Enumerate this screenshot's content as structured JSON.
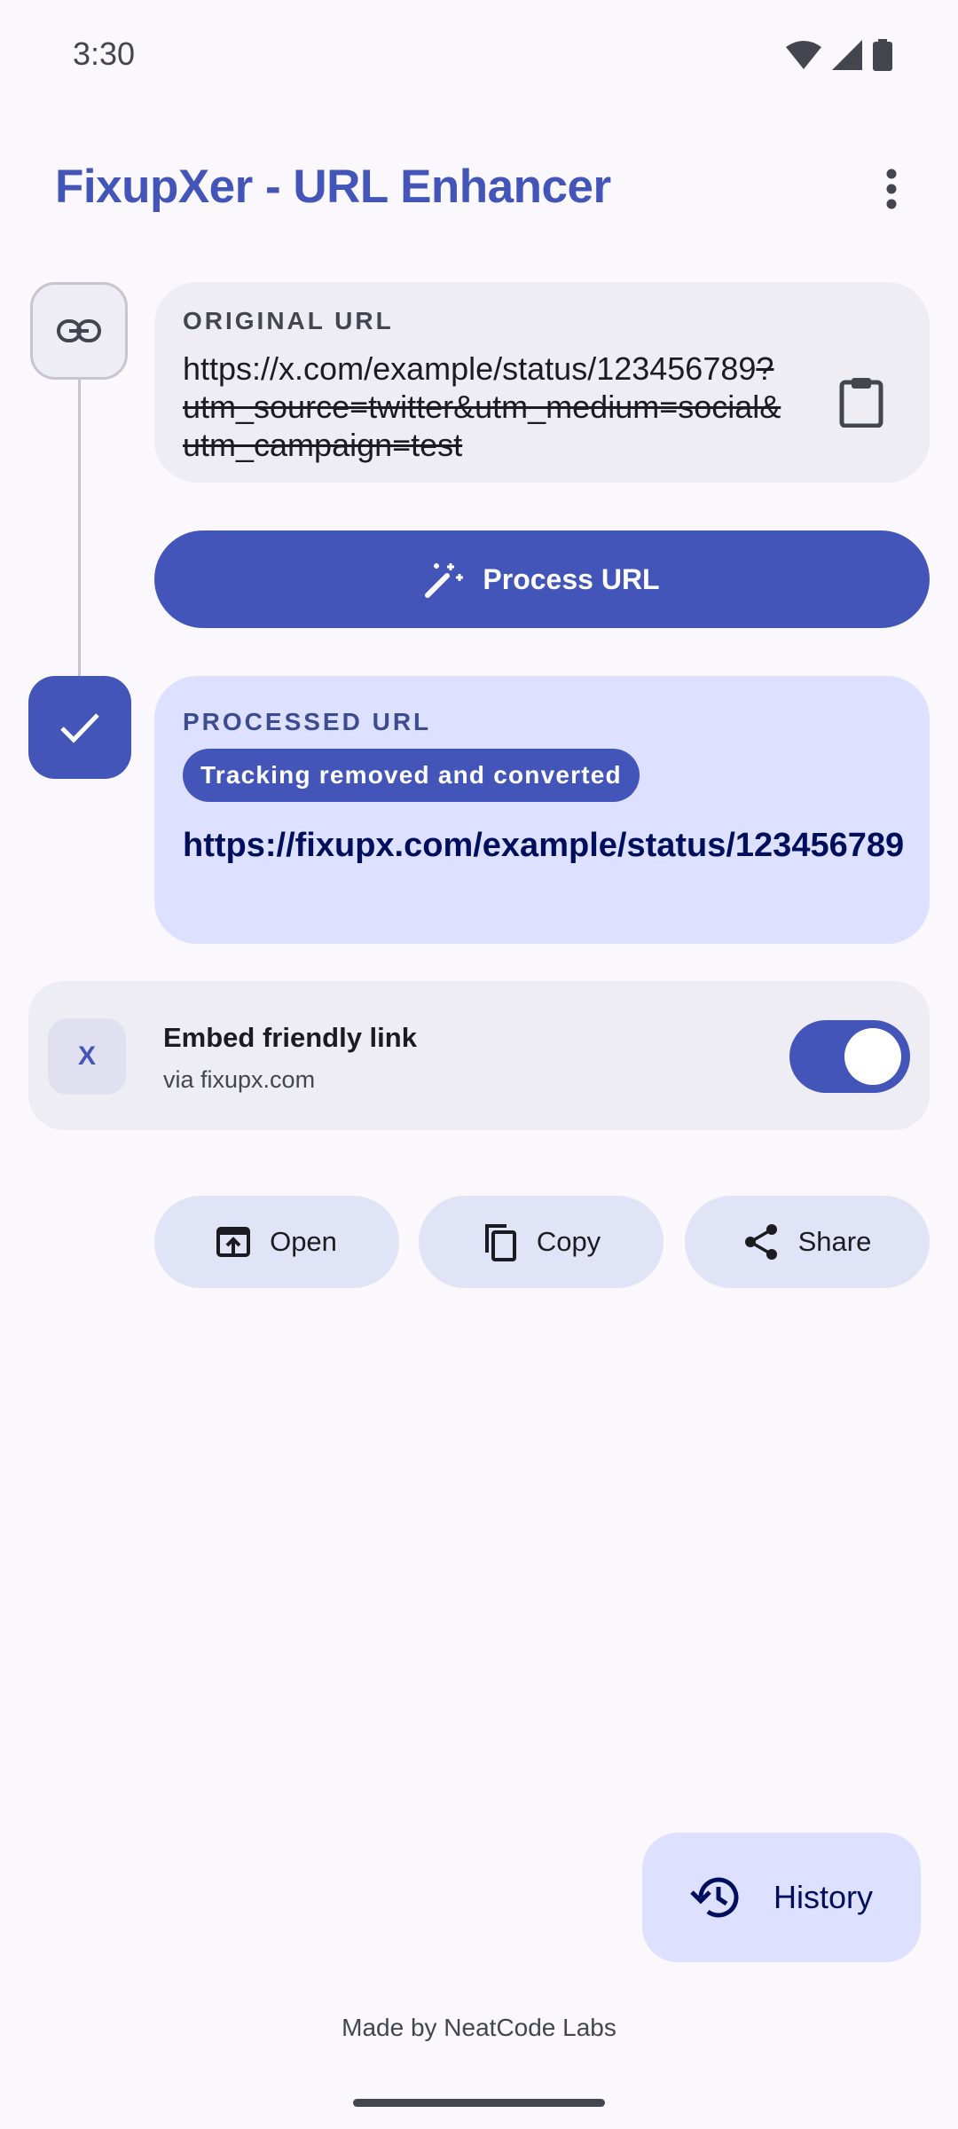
{
  "status_bar": {
    "time": "3:30"
  },
  "app_bar": {
    "title": "FixupXer - URL Enhancer"
  },
  "original": {
    "label": "ORIGINAL URL",
    "url_kept": "https://x.com/example/status/123456789",
    "url_removed": "?utm_source=twitter&utm_medium=social&utm_campaign=test"
  },
  "process_button": {
    "label": "Process URL"
  },
  "processed": {
    "label": "PROCESSED URL",
    "badge": "Tracking removed and converted",
    "url": "https://fixupx.com/example/status/123456789"
  },
  "embed": {
    "avatar": "X",
    "title": "Embed friendly link",
    "subtitle": "via fixupx.com",
    "enabled": true
  },
  "actions": {
    "open": "Open",
    "copy": "Copy",
    "share": "Share"
  },
  "history": {
    "label": "History"
  },
  "footer": {
    "text": "Made by NeatCode Labs"
  },
  "colors": {
    "primary": "#4355B9",
    "primary_container": "#DDE1FF",
    "surface": "#FAF7FD"
  },
  "icons": [
    "link-icon",
    "check-icon",
    "content-paste-icon",
    "magic-wand-icon",
    "open-in-browser-icon",
    "copy-icon",
    "share-icon",
    "history-icon",
    "more-vert-icon"
  ]
}
